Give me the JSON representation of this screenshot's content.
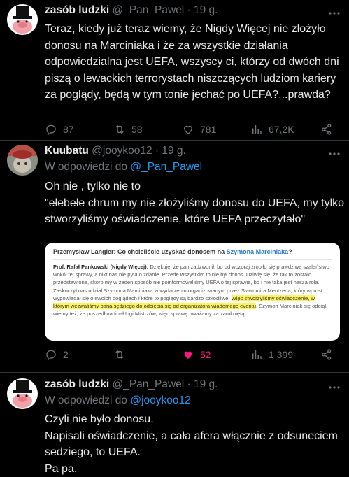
{
  "tweets": [
    {
      "author": "zasób ludzki",
      "handle": "@_Pan_Pawel · 19 g.",
      "text": "Teraz, kiedy już teraz wiemy, że Nigdy Więcej nie złożyło donosu na Marciniaka i że za wszystkie działania odpowiedzialna jest UEFA, wszyscy ci, którzy od dwóch dni piszą o lewackich terrorystach niszczących ludziom kariery za poglądy, będą w tym tonie jechać po UEFA?...prawda?",
      "replies": "87",
      "retweets": "58",
      "likes": "781",
      "views": "67,2K"
    },
    {
      "author": "Kuubatu",
      "handle": "@jooykoo12 · 19 g.",
      "reply_prefix": "W odpowiedzi do ",
      "reply_to": "@_Pan_Pawel",
      "text": "Oh nie , tylko nie to\n\"ełebełe chrum my nie złożyliśmy donosu do UEFA, my tylko stworzyliśmy oświadczenie, które UEFA przeczytało\"",
      "replies": "2",
      "retweets": "",
      "likes": "52",
      "views": "1 399",
      "embed": {
        "question_prefix": "Przemysław Langier: Co chcieliście uzyskać donosem na ",
        "question_name": "Szymona Marciniaka",
        "question_suffix": "?",
        "speaker": "Prof. Rafał Pankowski (Nigdy Więcej):",
        "body_before": " Dziękuję, że pan zadzwonił, bo od wczoraj zrobiło się prawdziwe szaleństwo wokół tej sprawy, a nikt nas nie pyta o zdanie. Przede wszystkim to nie był donos. Dziwię się, że tak to zostało przedstawione, skoro my w żaden sposób nie poinformowaliśmy UEFA o tej sprawie, bo i nie taka jest nasza rola. Zaskoczył nas udział Szymona Marciniaka w wydarzeniu organizowanym przez Sławomira Mentzena, który wprost wypowiadał się o swoich poglądach i które to poglądy są bardzo szkodliwe. ",
        "body_highlight": "Więc stworzyliśmy oświadczenie, w którym wezwaliśmy pana sędziego do odcięcia się od organizatora wiadomego eventu",
        "body_after": ". Szymon Marciniak się odciął, wiemy też, że poszedł na finał Ligi Mistrzów, więc sprawę uważamy za zamkniętą."
      }
    },
    {
      "author": "zasób ludzki",
      "handle": "@_Pan_Pawel · 19 g.",
      "reply_prefix": "W odpowiedzi do ",
      "reply_to": "@jooykoo12",
      "text": "Czyli nie było donosu.\nNapisali oświadczenie, a cała afera włącznie z odsuneciem sedziego, to UEFA.\nPa pa."
    }
  ],
  "colors": {
    "background": "#000000",
    "text": "#e7e9ea",
    "muted": "#71767b",
    "link": "#1d9bf0",
    "like_active": "#f91880",
    "divider": "#2f3336"
  },
  "icons": [
    "reply-icon",
    "retweet-icon",
    "like-icon",
    "views-icon",
    "share-icon",
    "more-icon"
  ]
}
